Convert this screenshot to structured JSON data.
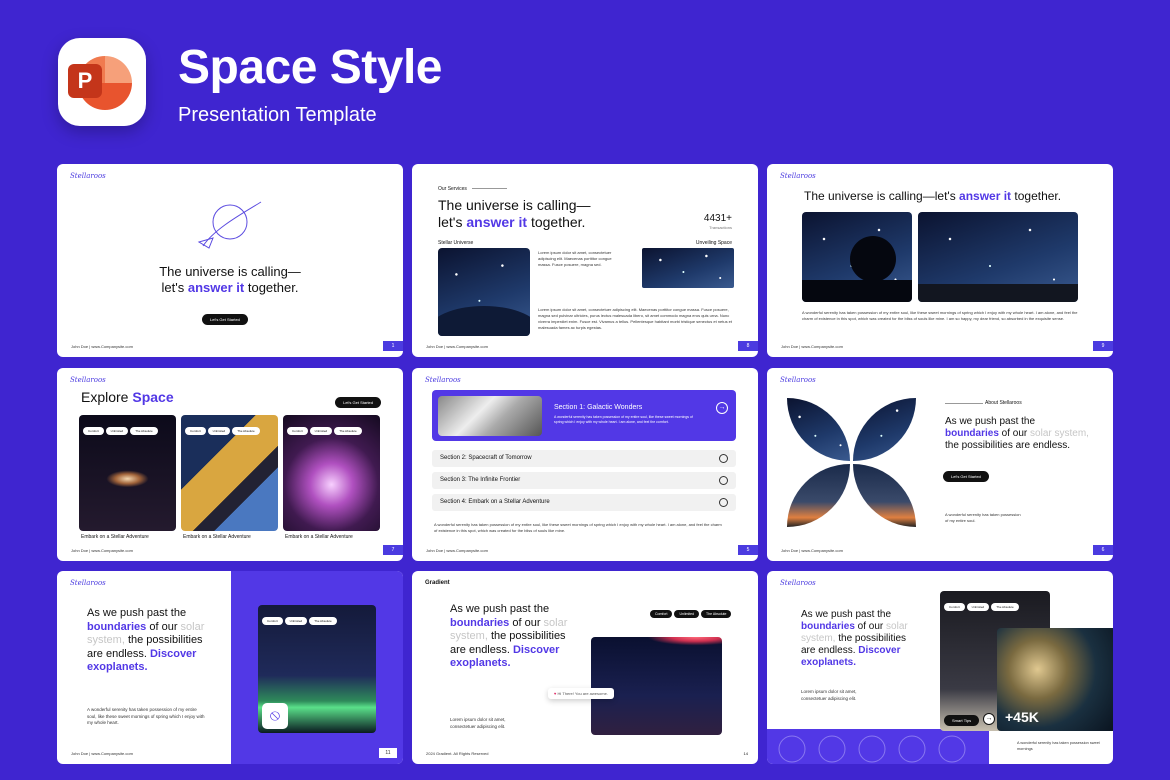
{
  "header": {
    "logo_letter": "P",
    "title": "Space Style",
    "subtitle": "Presentation Template"
  },
  "brand": "Stellaroos",
  "footer": "John Doe | www.Companysite.com",
  "s1": {
    "l1": "The universe is calling—",
    "l2a": "let's ",
    "l2b": "answer it",
    "l2c": " together.",
    "btn": "Let's Get Started",
    "page": "1"
  },
  "s2": {
    "label": "Our Services",
    "l1": "The universe is calling—",
    "l2a": "let's ",
    "l2b": "answer it",
    "l2c": " together.",
    "stat": "4431+",
    "stat_label": "Transactions",
    "cap1": "Stellar Universe",
    "cap2": "Unveiling Space",
    "t1": "Lorem ipsum dolor sit amet, consectetuer adipiscing elit. Maecenas porttitor congue massa. Fusce posuere, magna sed.",
    "t2": "Lorem ipsum dolor sit amet, consectetuer adipiscing elit. Maecenas porttitor congue massa. Fusce posuere, magna sed pulvinar ultricies, purus lectus malesuada libero, sit amet commodo magna eros quis urna. Nunc viverra imperdiet enim. Fusce est. Vivamus a tellus. Pellentesque habitant morbi tristique senectus et netus et malesuada fames ac turpis egestas.",
    "page": "8"
  },
  "s3": {
    "ha": "The universe is calling—let's ",
    "hb": "answer it",
    "hc": " together.",
    "t": "A wonderful serenity has taken possession of my entire soul, like these sweet mornings of spring which I enjoy with my whole heart. I am alone, and feel the charm of existence in this spot, which was created for the bliss of souls like mine. I am so happy, my dear friend, so absorbed in the exquisite sense.",
    "page": "9"
  },
  "s4": {
    "ha": "Explore ",
    "hb": "Space",
    "btn": "Let's Get Started",
    "tags": [
      "Comfort",
      "Unlimited",
      "The Absolute"
    ],
    "caps": [
      "Embark on a Stellar Adventure",
      "Embark on a Stellar Adventure",
      "Embark on a Stellar Adventure"
    ],
    "page": "7"
  },
  "s5": {
    "sec1": "Section 1: Galactic Wonders",
    "sec1t": "A wonderful serenity has taken possession of my entire soul, like these sweet mornings of spring which I enjoy with my whole heart. I am alone, and feel the comfort.",
    "sec2": "Section 2: Spacecraft of Tomorrow",
    "sec3": "Section 3: The Infinite Frontier",
    "sec4": "Section 4: Embark on a Stellar Adventure",
    "t": "A wonderful serenity has taken possession of my entire soul, like these sweet mornings of spring which I enjoy with my whole heart. I am alone, and feel the charm of existence in this spot, which was created for the bliss of souls like mine.",
    "page": "5"
  },
  "s6": {
    "label": "About Stellaroos",
    "l1": "As we push past the",
    "l2a": "boundaries",
    "l2b": " of our ",
    "l2c": "solar system,",
    "l3": "the possibilities are endless.",
    "btn": "Let's Get Started",
    "t": "A wonderful serenity has taken possession of my entire soul.",
    "page": "6"
  },
  "s7": {
    "l1": "As we push past the",
    "l2a": "boundaries",
    "l2b": " of our ",
    "l2c": "solar",
    "l3a": "system,",
    "l3b": " the possibilities",
    "l4a": "are endless. ",
    "l4b": "Discover",
    "l5": "exoplanets.",
    "t": "A wonderful serenity has taken possession of my entire soul, like these sweet mornings of spring which I enjoy with my whole heart.",
    "tags": [
      "Comfort",
      "Unlimited",
      "The Absolute"
    ],
    "page": "11"
  },
  "s8": {
    "brand": "Gradient",
    "l1": "As we push past the",
    "l2a": "boundaries",
    "l2b": " of our ",
    "l2c": "solar",
    "l3a": "system,",
    "l3b": " the possibilities",
    "l4a": "are endless. ",
    "l4b": "Discover",
    "l5": "exoplanets.",
    "tags": [
      "Comfort",
      "Unlimited",
      "The Absolute"
    ],
    "chat": "Hi There! You are awesome.",
    "t": "Lorem ipsum dolor sit amet, consectetuer adipiscing elit.",
    "foot": "2024 Gradient. All Rights Reserved",
    "page": "14"
  },
  "s9": {
    "l1": "As we push past the",
    "l2a": "boundaries",
    "l2b": " of our ",
    "l2c": "solar",
    "l3a": "system,",
    "l3b": " the possibilities",
    "l4a": "are endless. ",
    "l4b": "Discover",
    "l5": "exoplanets.",
    "tags": [
      "Comfort",
      "Unlimited",
      "The Absolute"
    ],
    "btn": "Smart Tips",
    "stat": "+45K",
    "t": "Lorem ipsum dolor sit amet, consectetuer adipiscing elit.",
    "t2": "A wonderful serenity has taken possession sweet mornings"
  }
}
